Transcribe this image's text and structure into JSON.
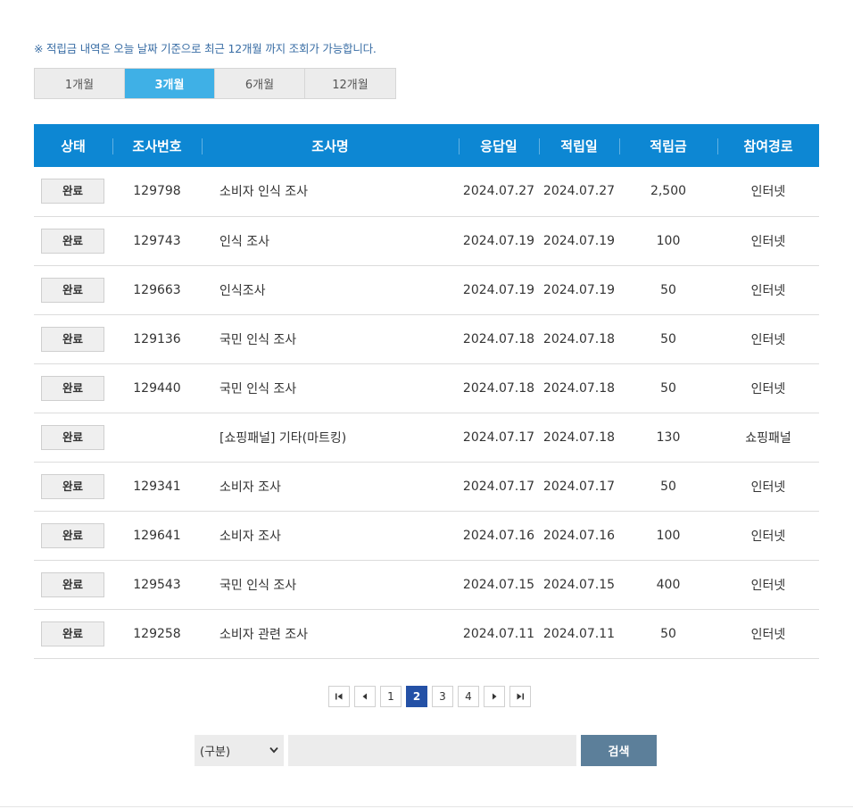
{
  "notice": "※ 적립금 내역은 오늘 날짜 기준으로 최근 12개월 까지 조회가 가능합니다.",
  "period_tabs": [
    {
      "label": "1개월",
      "active": false
    },
    {
      "label": "3개월",
      "active": true
    },
    {
      "label": "6개월",
      "active": false
    },
    {
      "label": "12개월",
      "active": false
    }
  ],
  "table": {
    "headers": [
      "상태",
      "조사번호",
      "조사명",
      "응답일",
      "적립일",
      "적립금",
      "참여경로"
    ],
    "rows": [
      {
        "status": "완료",
        "no": "129798",
        "title": "소비자 인식 조사",
        "answered": "2024.07.27",
        "credited": "2024.07.27",
        "amount": "2,500",
        "route": "인터넷"
      },
      {
        "status": "완료",
        "no": "129743",
        "title": "인식 조사",
        "answered": "2024.07.19",
        "credited": "2024.07.19",
        "amount": "100",
        "route": "인터넷"
      },
      {
        "status": "완료",
        "no": "129663",
        "title": "인식조사",
        "answered": "2024.07.19",
        "credited": "2024.07.19",
        "amount": "50",
        "route": "인터넷"
      },
      {
        "status": "완료",
        "no": "129136",
        "title": "국민 인식 조사",
        "answered": "2024.07.18",
        "credited": "2024.07.18",
        "amount": "50",
        "route": "인터넷"
      },
      {
        "status": "완료",
        "no": "129440",
        "title": "국민 인식 조사",
        "answered": "2024.07.18",
        "credited": "2024.07.18",
        "amount": "50",
        "route": "인터넷"
      },
      {
        "status": "완료",
        "no": "",
        "title": "[쇼핑패널] 기타(마트킹)",
        "answered": "2024.07.17",
        "credited": "2024.07.18",
        "amount": "130",
        "route": "쇼핑패널"
      },
      {
        "status": "완료",
        "no": "129341",
        "title": "소비자 조사",
        "answered": "2024.07.17",
        "credited": "2024.07.17",
        "amount": "50",
        "route": "인터넷"
      },
      {
        "status": "완료",
        "no": "129641",
        "title": "소비자 조사",
        "answered": "2024.07.16",
        "credited": "2024.07.16",
        "amount": "100",
        "route": "인터넷"
      },
      {
        "status": "완료",
        "no": "129543",
        "title": "국민 인식 조사",
        "answered": "2024.07.15",
        "credited": "2024.07.15",
        "amount": "400",
        "route": "인터넷"
      },
      {
        "status": "완료",
        "no": "129258",
        "title": "소비자 관련 조사",
        "answered": "2024.07.11",
        "credited": "2024.07.11",
        "amount": "50",
        "route": "인터넷"
      }
    ]
  },
  "pagination": {
    "pages": [
      "1",
      "2",
      "3",
      "4"
    ],
    "current": "2",
    "icons": [
      "first-page-icon",
      "prev-page-icon",
      "next-page-icon",
      "last-page-icon"
    ]
  },
  "search": {
    "select_value": "(구분)",
    "input_value": "",
    "button_label": "검색"
  },
  "colors": {
    "header_bg": "#0d87d3",
    "active_tab": "#3fb0e6",
    "active_page": "#2451a6",
    "search_button": "#5c7f9a",
    "notice_text": "#3a6ea5"
  }
}
